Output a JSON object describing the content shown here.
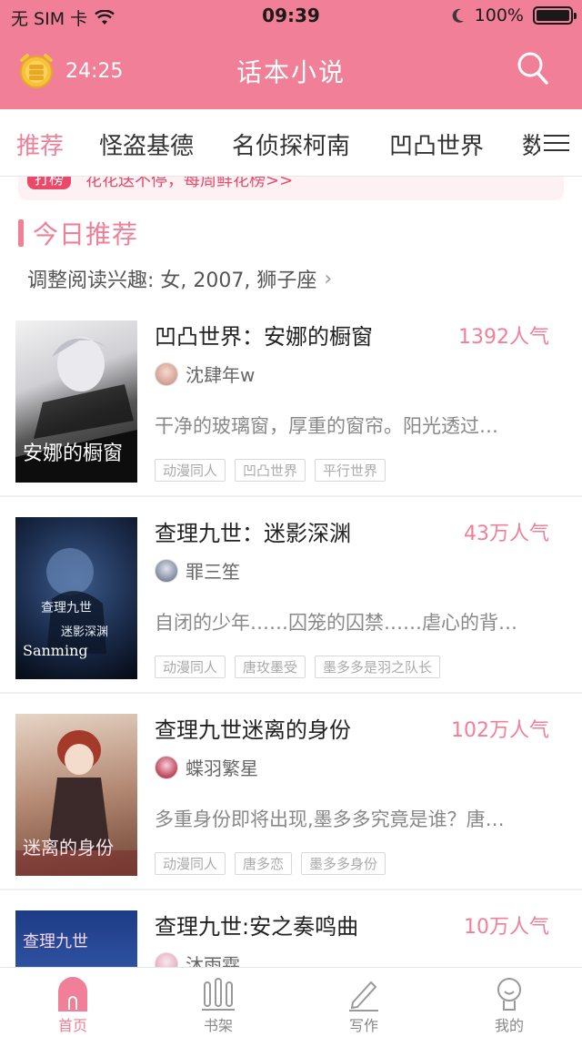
{
  "status_bar": {
    "carrier": "无 SIM 卡",
    "time": "09:39",
    "battery": "100%"
  },
  "header": {
    "timer": "24:25",
    "title": "话本小说"
  },
  "tabs": [
    {
      "label": "推荐",
      "active": true
    },
    {
      "label": "怪盗基德",
      "active": false
    },
    {
      "label": "名侦探柯南",
      "active": false
    },
    {
      "label": "凹凸世界",
      "active": false
    },
    {
      "label": "数",
      "active": false
    }
  ],
  "banner": {
    "tag": "打榜",
    "text": "花花送不停，每周鲜花榜>>"
  },
  "section": {
    "title": "今日推荐",
    "interest": "调整阅读兴趣: 女, 2007, 狮子座"
  },
  "books": [
    {
      "title": "凹凸世界：安娜的橱窗",
      "popularity": "1392人气",
      "author": "沈肆年w",
      "description": "干净的玻璃窗，厚重的窗帘。阳光透过…",
      "tags": [
        "动漫同人",
        "凹凸世界",
        "平行世界"
      ],
      "cover_text": "安娜的橱窗"
    },
    {
      "title": "查理九世：迷影深渊",
      "popularity": "43万人气",
      "author": "罪三笙",
      "description": "自闭的少年……囚笼的囚禁……虐心的背…",
      "tags": [
        "动漫同人",
        "唐玫墨受",
        "墨多多是羽之队长"
      ],
      "cover_text": "Sanming"
    },
    {
      "title": "查理九世迷离的身份",
      "popularity": "102万人气",
      "author": "蝶羽繁星",
      "description": "多重身份即将出现,墨多多究竟是谁？唐…",
      "tags": [
        "动漫同人",
        "唐多恋",
        "墨多多身份"
      ],
      "cover_text": "迷离的身份"
    },
    {
      "title": "查理九世:安之奏鸣曲",
      "popularity": "10万人气",
      "author": "沐雨霖",
      "description": "",
      "tags": [],
      "cover_text": "查理九世"
    }
  ],
  "bottom_nav": [
    {
      "label": "首页",
      "icon": "home-icon",
      "active": true
    },
    {
      "label": "书架",
      "icon": "bookshelf-icon",
      "active": false
    },
    {
      "label": "写作",
      "icon": "pen-icon",
      "active": false
    },
    {
      "label": "我的",
      "icon": "profile-icon",
      "active": false
    }
  ],
  "colors": {
    "accent": "#f07f97",
    "text": "#333333",
    "muted": "#888888"
  }
}
